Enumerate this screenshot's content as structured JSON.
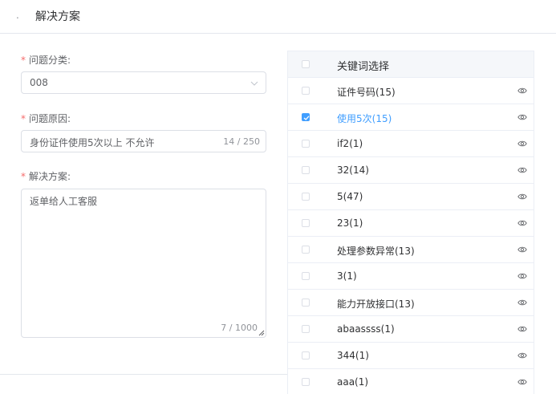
{
  "header": {
    "dot": ".",
    "title": "解决方案"
  },
  "form": {
    "problem_type": {
      "required": "*",
      "label": "问题分类:",
      "value": "008"
    },
    "problem_cause": {
      "required": "*",
      "label": "问题原因:",
      "value": "身份证件使用5次以上 不允许",
      "count": "14 / 250"
    },
    "solution": {
      "required": "*",
      "label": "解决方案:",
      "value": "返单给人工客服",
      "count": "7 / 1000"
    }
  },
  "keywords": {
    "header": "关键词选择",
    "items": [
      {
        "label": "证件号码(15)",
        "checked": false
      },
      {
        "label": "使用5次(15)",
        "checked": true
      },
      {
        "label": "if2(1)",
        "checked": false
      },
      {
        "label": "32(14)",
        "checked": false
      },
      {
        "label": "5(47)",
        "checked": false
      },
      {
        "label": "23(1)",
        "checked": false
      },
      {
        "label": "处理参数异常(13)",
        "checked": false
      },
      {
        "label": "3(1)",
        "checked": false
      },
      {
        "label": "能力开放接口(13)",
        "checked": false
      },
      {
        "label": "abaassss(1)",
        "checked": false
      },
      {
        "label": "344(1)",
        "checked": false
      },
      {
        "label": "aaa(1)",
        "checked": false
      }
    ]
  },
  "colors": {
    "accent": "#409eff",
    "required": "#f56c6c",
    "border": "#dcdfe6"
  },
  "icons": {
    "row_action": "eye-icon",
    "select_arrow": "chevron-down-icon"
  }
}
